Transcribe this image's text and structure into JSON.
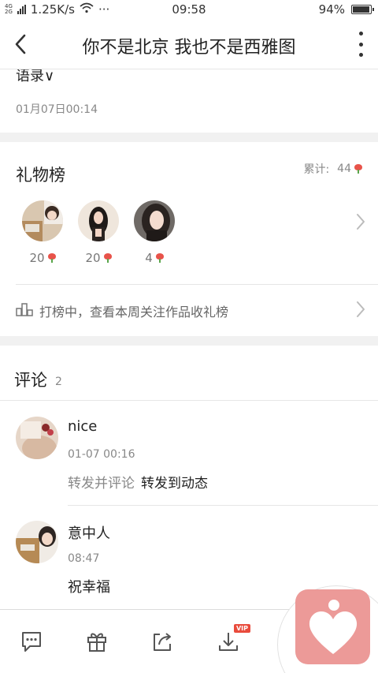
{
  "status_bar": {
    "network_type_top": "4G",
    "network_type_bottom": "2G",
    "speed": "1.25K/s",
    "more": "···",
    "time": "09:58",
    "battery_percent": "94%",
    "battery_level": 0.94,
    "icons": [
      "signal-icon",
      "wifi-icon",
      "battery-icon"
    ]
  },
  "title_bar": {
    "title": "你不是北京 我也不是西雅图",
    "icons": [
      "back-arrow-icon",
      "more-vertical-icon"
    ]
  },
  "post": {
    "text_tail": "语录∨",
    "date": "01月07日00:14"
  },
  "gift_board": {
    "title": "礼物榜",
    "total_label": "累计:",
    "total_value": "44",
    "donors": [
      {
        "count": "20"
      },
      {
        "count": "20"
      },
      {
        "count": "4"
      }
    ],
    "rank_text": "打榜中，查看本周关注作品收礼榜",
    "icons": [
      "rose-icon",
      "chevron-right-icon",
      "podium-icon"
    ]
  },
  "comments": {
    "title": "评论",
    "count": "2",
    "items": [
      {
        "name": "nice",
        "time": "01-07 00:16",
        "action_1": "转发并评论",
        "action_2": "转发到动态"
      },
      {
        "name": "意中人",
        "time": "08:47",
        "text": "祝幸福"
      }
    ]
  },
  "bottom_bar": {
    "vip_badge": "VIP",
    "icons": [
      "comment-icon",
      "gift-icon",
      "share-icon",
      "download-icon",
      "heart-app-icon"
    ]
  },
  "colors": {
    "accent_pink": "#ec9a98",
    "rose_red": "#e8534a",
    "vip_red": "#e94b3c",
    "divider_gray": "#f1f1f1"
  }
}
